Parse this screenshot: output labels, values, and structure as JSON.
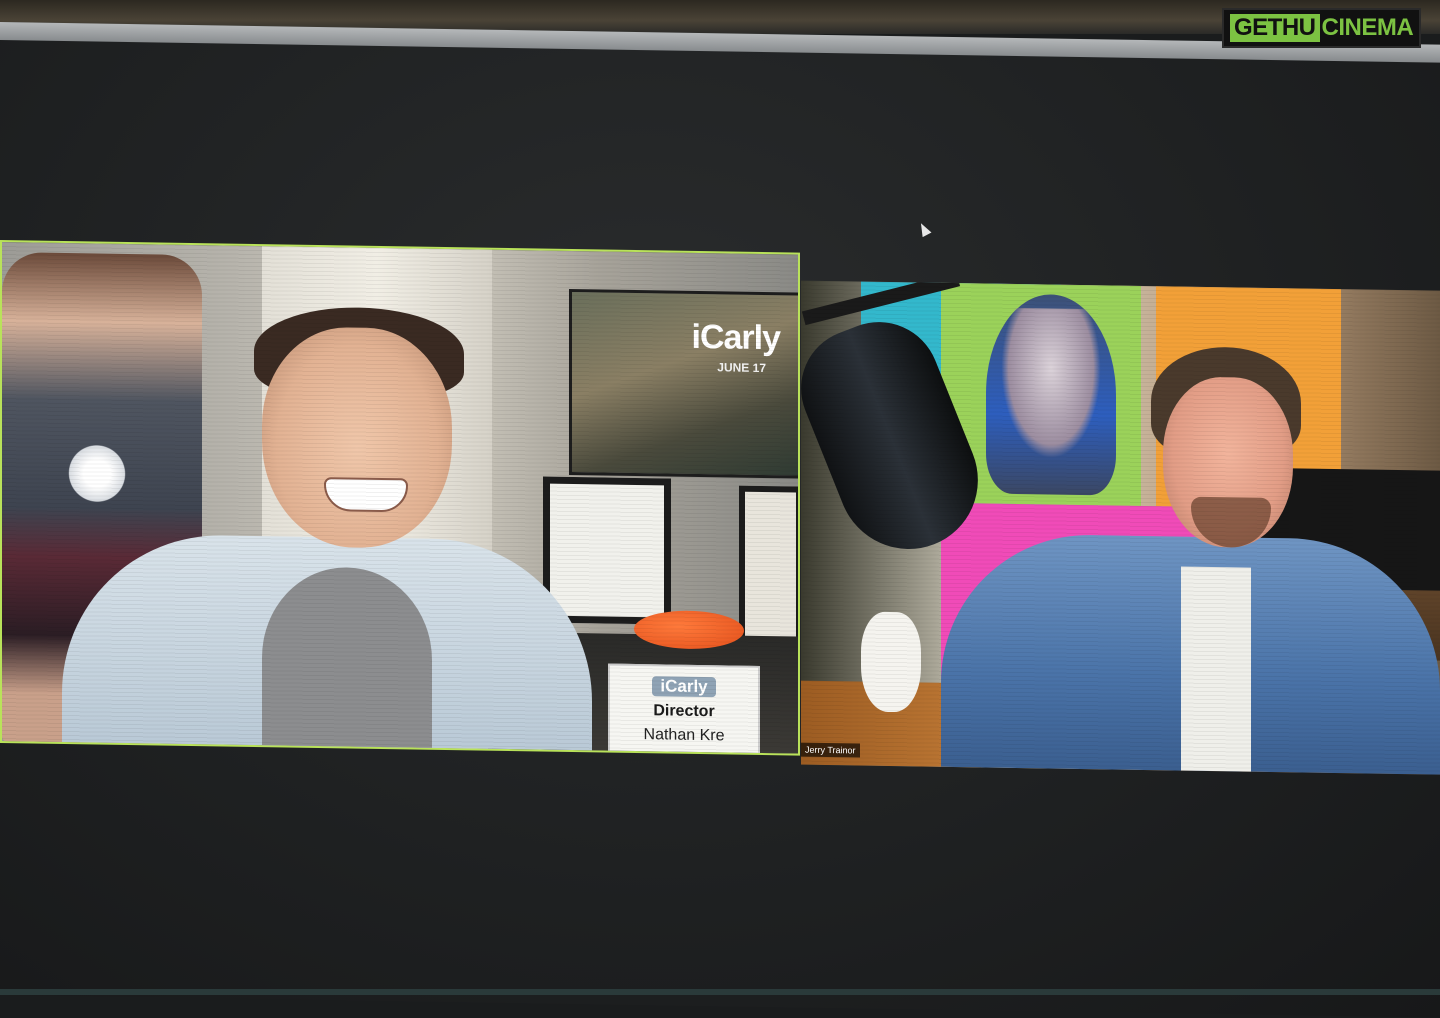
{
  "watermark": {
    "part1": "GETHU",
    "part2": "CINEMA"
  },
  "call": {
    "left_tile": {
      "poster_logo": "iCarly",
      "poster_date": "JUNE 17",
      "placard_logo": "iCarly",
      "placard_role": "Director",
      "placard_name": "Nathan Kre"
    },
    "right_tile": {
      "participant_name": "Jerry Trainor"
    }
  },
  "colors": {
    "active_speaker_border": "#b9e25a",
    "watermark_green": "#7cc242"
  }
}
